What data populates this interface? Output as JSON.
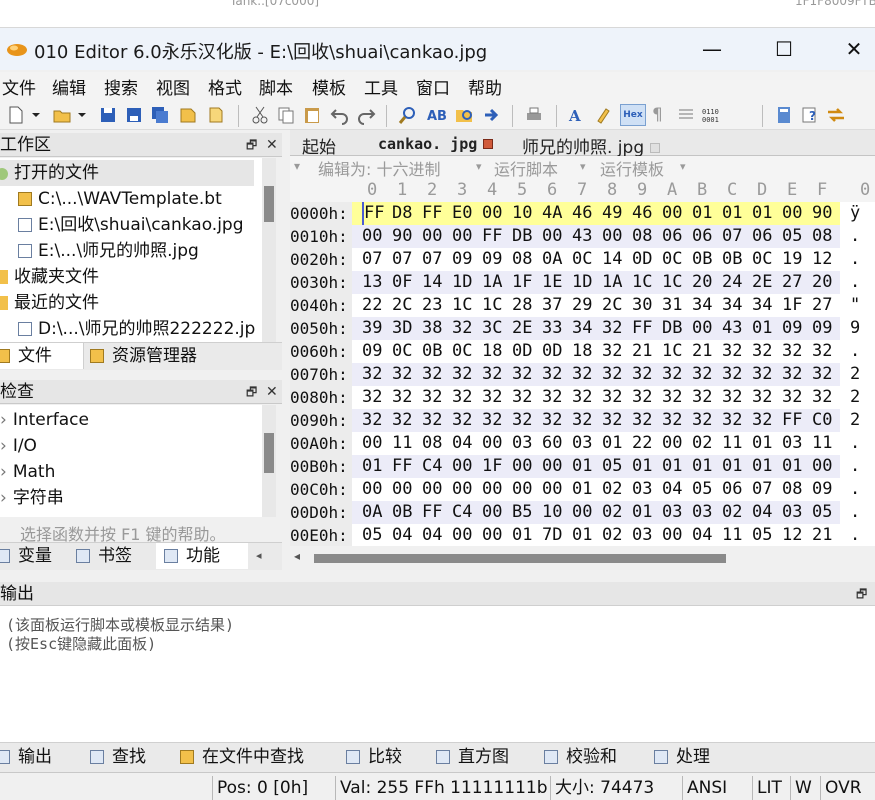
{
  "window": {
    "title": "010 Editor 6.0永乐汉化版 - E:\\回收\\shuai\\cankao.jpg",
    "minimize": "—",
    "maximize": "☐",
    "close": "✕"
  },
  "menu": [
    "文件",
    "编辑",
    "搜索",
    "视图",
    "格式",
    "脚本",
    "模板",
    "工具",
    "窗口",
    "帮助"
  ],
  "workspace": {
    "title": "工作区",
    "sections": {
      "open_files": "打开的文件",
      "favorites": "收藏夹文件",
      "recent": "最近的文件"
    },
    "open_files": [
      "C:\\...\\WAVTemplate.bt",
      "E:\\回收\\shuai\\cankao.jpg",
      "E:\\...\\师兄的帅照.jpg"
    ],
    "recent_files": [
      "D:\\...\\师兄的帅照222222.jp"
    ],
    "tabs": [
      "文件",
      "资源管理器"
    ]
  },
  "inspector": {
    "title": "检查",
    "items": [
      "Interface",
      "I/O",
      "Math",
      "字符串"
    ],
    "help_text": "选择函数并按 F1 键的帮助。",
    "tabs": [
      "变量",
      "书签",
      "功能"
    ]
  },
  "editor": {
    "tabs": [
      "起始",
      "cankao. jpg",
      "师兄的帅照. jpg"
    ],
    "options": {
      "edit_as": "编辑为: 十六进制",
      "run_script": "运行脚本",
      "run_template": "运行模板"
    },
    "columns": [
      "0",
      "1",
      "2",
      "3",
      "4",
      "5",
      "6",
      "7",
      "8",
      "9",
      "A",
      "B",
      "C",
      "D",
      "E",
      "F",
      "0"
    ],
    "rows": [
      {
        "addr": "0000h:",
        "bytes": [
          "FF",
          "D8",
          "FF",
          "E0",
          "00",
          "10",
          "4A",
          "46",
          "49",
          "46",
          "00",
          "01",
          "01",
          "01",
          "00",
          "90"
        ],
        "ascii": "ÿ"
      },
      {
        "addr": "0010h:",
        "bytes": [
          "00",
          "90",
          "00",
          "00",
          "FF",
          "DB",
          "00",
          "43",
          "00",
          "08",
          "06",
          "06",
          "07",
          "06",
          "05",
          "08"
        ],
        "ascii": "."
      },
      {
        "addr": "0020h:",
        "bytes": [
          "07",
          "07",
          "07",
          "09",
          "09",
          "08",
          "0A",
          "0C",
          "14",
          "0D",
          "0C",
          "0B",
          "0B",
          "0C",
          "19",
          "12"
        ],
        "ascii": "."
      },
      {
        "addr": "0030h:",
        "bytes": [
          "13",
          "0F",
          "14",
          "1D",
          "1A",
          "1F",
          "1E",
          "1D",
          "1A",
          "1C",
          "1C",
          "20",
          "24",
          "2E",
          "27",
          "20"
        ],
        "ascii": "."
      },
      {
        "addr": "0040h:",
        "bytes": [
          "22",
          "2C",
          "23",
          "1C",
          "1C",
          "28",
          "37",
          "29",
          "2C",
          "30",
          "31",
          "34",
          "34",
          "34",
          "1F",
          "27"
        ],
        "ascii": "\""
      },
      {
        "addr": "0050h:",
        "bytes": [
          "39",
          "3D",
          "38",
          "32",
          "3C",
          "2E",
          "33",
          "34",
          "32",
          "FF",
          "DB",
          "00",
          "43",
          "01",
          "09",
          "09"
        ],
        "ascii": "9"
      },
      {
        "addr": "0060h:",
        "bytes": [
          "09",
          "0C",
          "0B",
          "0C",
          "18",
          "0D",
          "0D",
          "18",
          "32",
          "21",
          "1C",
          "21",
          "32",
          "32",
          "32",
          "32"
        ],
        "ascii": "."
      },
      {
        "addr": "0070h:",
        "bytes": [
          "32",
          "32",
          "32",
          "32",
          "32",
          "32",
          "32",
          "32",
          "32",
          "32",
          "32",
          "32",
          "32",
          "32",
          "32",
          "32"
        ],
        "ascii": "2"
      },
      {
        "addr": "0080h:",
        "bytes": [
          "32",
          "32",
          "32",
          "32",
          "32",
          "32",
          "32",
          "32",
          "32",
          "32",
          "32",
          "32",
          "32",
          "32",
          "32",
          "32"
        ],
        "ascii": "2"
      },
      {
        "addr": "0090h:",
        "bytes": [
          "32",
          "32",
          "32",
          "32",
          "32",
          "32",
          "32",
          "32",
          "32",
          "32",
          "32",
          "32",
          "32",
          "32",
          "FF",
          "C0"
        ],
        "ascii": "2"
      },
      {
        "addr": "00A0h:",
        "bytes": [
          "00",
          "11",
          "08",
          "04",
          "00",
          "03",
          "60",
          "03",
          "01",
          "22",
          "00",
          "02",
          "11",
          "01",
          "03",
          "11"
        ],
        "ascii": "."
      },
      {
        "addr": "00B0h:",
        "bytes": [
          "01",
          "FF",
          "C4",
          "00",
          "1F",
          "00",
          "00",
          "01",
          "05",
          "01",
          "01",
          "01",
          "01",
          "01",
          "01",
          "00"
        ],
        "ascii": "."
      },
      {
        "addr": "00C0h:",
        "bytes": [
          "00",
          "00",
          "00",
          "00",
          "00",
          "00",
          "00",
          "01",
          "02",
          "03",
          "04",
          "05",
          "06",
          "07",
          "08",
          "09"
        ],
        "ascii": "."
      },
      {
        "addr": "00D0h:",
        "bytes": [
          "0A",
          "0B",
          "FF",
          "C4",
          "00",
          "B5",
          "10",
          "00",
          "02",
          "01",
          "03",
          "03",
          "02",
          "04",
          "03",
          "05"
        ],
        "ascii": "."
      },
      {
        "addr": "00E0h:",
        "bytes": [
          "05",
          "04",
          "04",
          "00",
          "00",
          "01",
          "7D",
          "01",
          "02",
          "03",
          "00",
          "04",
          "11",
          "05",
          "12",
          "21"
        ],
        "ascii": "."
      }
    ]
  },
  "output": {
    "title": "输出",
    "lines": [
      "(该面板运行脚本或模板显示结果)",
      "(按Esc键隐藏此面板)"
    ],
    "tabs": [
      "输出",
      "查找",
      "在文件中查找",
      "比较",
      "直方图",
      "校验和",
      "处理"
    ]
  },
  "status": {
    "pos": "Pos: 0 [0h]",
    "val": "Val: 255 FFh 11111111b",
    "size": "大小: 74473",
    "ansi": "ANSI",
    "lit": "LIT",
    "w": "W",
    "ovr": "OVR"
  },
  "colors": {
    "selected_row_bg": "#ffff99",
    "cursor_bg": "#4a5bd4",
    "alt_row_bg": "#ececf8"
  }
}
